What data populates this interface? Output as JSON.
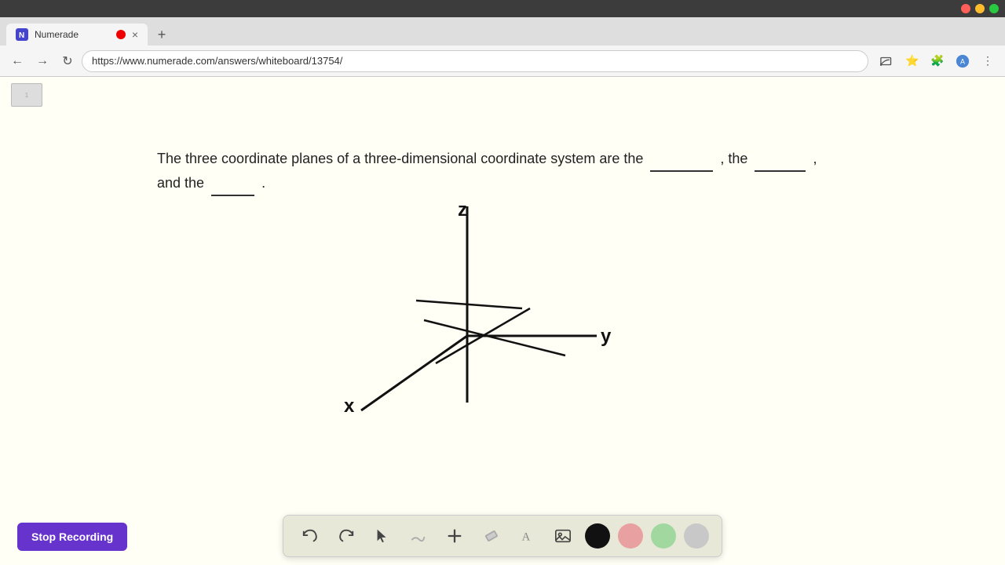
{
  "browser": {
    "tab_title": "Numerade",
    "url": "https://www.numerade.com/answers/whiteboard/13754/",
    "new_tab_icon": "+",
    "tab_close": "×"
  },
  "nav": {
    "back_icon": "←",
    "forward_icon": "→",
    "reload_icon": "↻"
  },
  "question": {
    "text_before": "The three coordinate planes of a three-dimensional coordinate system are the",
    "blank1": "________",
    "text_middle1": ", the",
    "blank2": "________",
    "text_middle2": ",",
    "text_newline": "and the",
    "blank3": "________",
    "text_end": "."
  },
  "diagram": {
    "x_label": "x",
    "y_label": "y",
    "z_label": "z"
  },
  "toolbar": {
    "undo_label": "undo",
    "redo_label": "redo",
    "select_label": "select",
    "pen_label": "pen",
    "add_label": "add",
    "eraser_label": "eraser",
    "text_label": "text",
    "image_label": "image",
    "colors": [
      "#111111",
      "#e8a0a0",
      "#a0d8a0",
      "#c8c8c8"
    ]
  },
  "stop_recording": {
    "label": "Stop Recording"
  }
}
